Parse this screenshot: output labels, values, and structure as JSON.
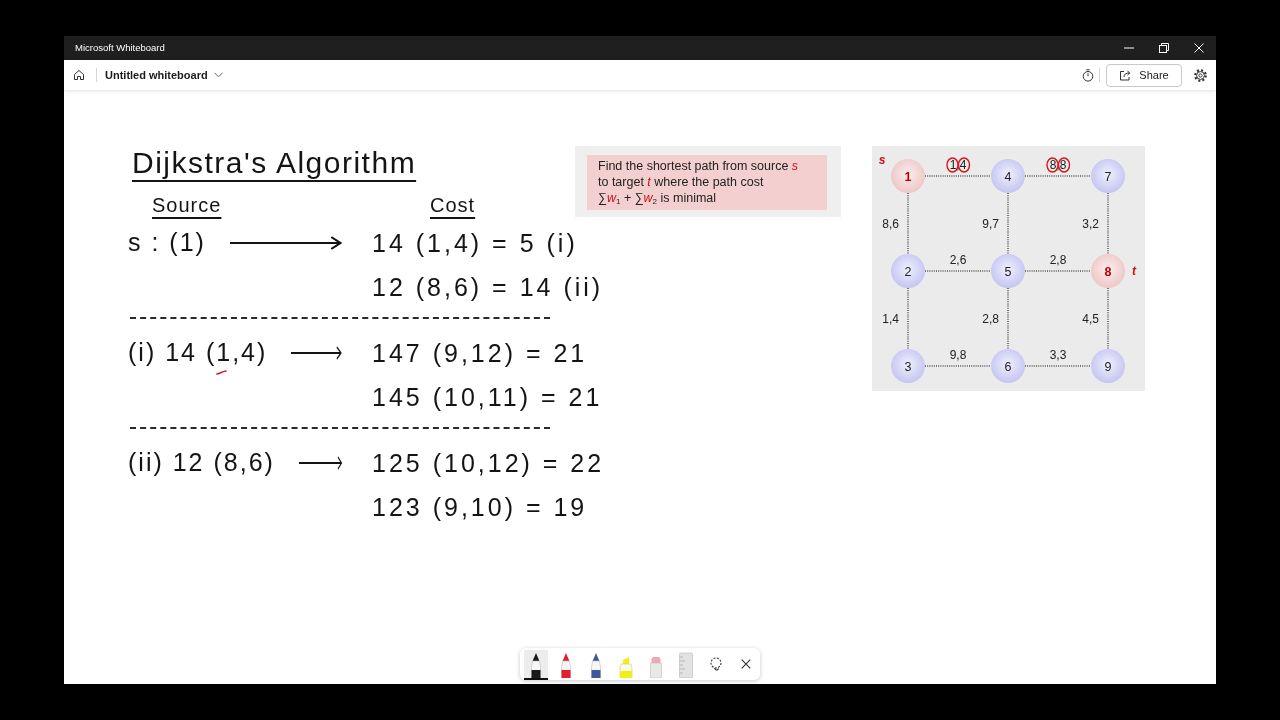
{
  "window": {
    "title": "Microsoft Whiteboard"
  },
  "app_bar": {
    "board_title": "Untitled whiteboard",
    "share_label": "Share"
  },
  "notes": {
    "heading": "Dijkstra's Algorithm",
    "source_header": "Source",
    "cost_header": "Cost",
    "steps": [
      {
        "source": "s : (1)",
        "ink_mark": false,
        "results": [
          "14 (1,4) = 5 (i)",
          "12 (8,6) = 14 (ii)"
        ]
      },
      {
        "source": "(i) 14 (1,4)",
        "ink_mark": true,
        "results": [
          "147 (9,12) = 21",
          "145 (10,11) = 21"
        ]
      },
      {
        "source": "(ii) 12 (8,6)",
        "ink_mark": false,
        "results": [
          "125 (10,12) = 22",
          "123 (9,10) = 19"
        ]
      }
    ]
  },
  "problem_card": {
    "lines": [
      "Find the shortest path from source *s*",
      "to target *t*  where the path cost",
      "∑*w*$_{1}$ + ∑*w*$_{2}$ is minimal"
    ]
  },
  "graph": {
    "rows": [
      {
        "nodes": [
          {
            "label": "1",
            "kind": "source",
            "tag": "s"
          },
          {
            "label": "4",
            "kind": "plain"
          },
          {
            "label": "7",
            "kind": "plain"
          }
        ],
        "links": [
          {
            "label": "1,4",
            "circled": true
          },
          {
            "label": "8,8",
            "circled": true
          }
        ],
        "down_links": [
          {
            "label": "8,6",
            "circled": false
          },
          {
            "label": "9,7",
            "circled": false
          },
          {
            "label": "3,2",
            "circled": false
          }
        ]
      },
      {
        "nodes": [
          {
            "label": "2",
            "kind": "plain"
          },
          {
            "label": "5",
            "kind": "plain"
          },
          {
            "label": "8",
            "kind": "target",
            "tag": "t"
          }
        ],
        "links": [
          {
            "label": "2,6",
            "circled": false
          },
          {
            "label": "2,8",
            "circled": false
          }
        ],
        "down_links": [
          {
            "label": "1,4",
            "circled": false
          },
          {
            "label": "2,8",
            "circled": false
          },
          {
            "label": "4,5",
            "circled": false
          }
        ]
      },
      {
        "nodes": [
          {
            "label": "3",
            "kind": "plain"
          },
          {
            "label": "6",
            "kind": "plain"
          },
          {
            "label": "9",
            "kind": "plain"
          }
        ],
        "links": [
          {
            "label": "9,8",
            "circled": false
          },
          {
            "label": "3,3",
            "circled": false
          }
        ]
      }
    ]
  },
  "toolbar": {
    "tools": [
      {
        "kind": "pen",
        "color": "#1a1a1a",
        "selected": true
      },
      {
        "kind": "pen",
        "color": "#e0202c",
        "selected": false
      },
      {
        "kind": "pen",
        "color": "#3d5a98",
        "selected": false
      },
      {
        "kind": "highlighter",
        "color": "#f2ee1a",
        "selected": false
      },
      {
        "kind": "eraser",
        "selected": false
      },
      {
        "kind": "ruler",
        "selected": false
      },
      {
        "kind": "lasso",
        "selected": false
      },
      {
        "kind": "close",
        "selected": false
      }
    ]
  }
}
